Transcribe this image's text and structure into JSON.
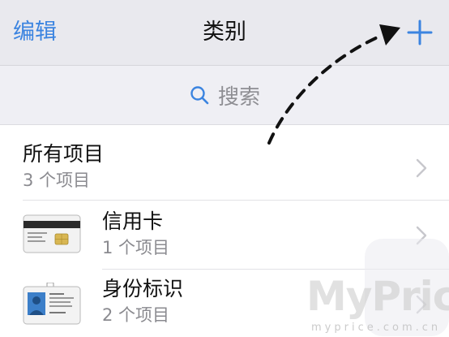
{
  "navbar": {
    "edit_label": "编辑",
    "title": "类别",
    "add_icon": "plus-icon"
  },
  "search": {
    "placeholder": "搜索",
    "icon": "search-icon"
  },
  "list": {
    "items": [
      {
        "title": "所有项目",
        "subtitle": "3 个项目",
        "icon": "none"
      },
      {
        "title": "信用卡",
        "subtitle": "1 个项目",
        "icon": "credit-card-icon"
      },
      {
        "title": "身份标识",
        "subtitle": "2 个项目",
        "icon": "id-card-icon"
      }
    ]
  },
  "watermark": {
    "brand": "MyPrice",
    "url": "myprice.com.cn"
  },
  "colors": {
    "accent": "#3b84e0",
    "navbar_bg": "#e9e9ee",
    "search_bg": "#efeff4",
    "subtitle": "#8a8a8f"
  }
}
